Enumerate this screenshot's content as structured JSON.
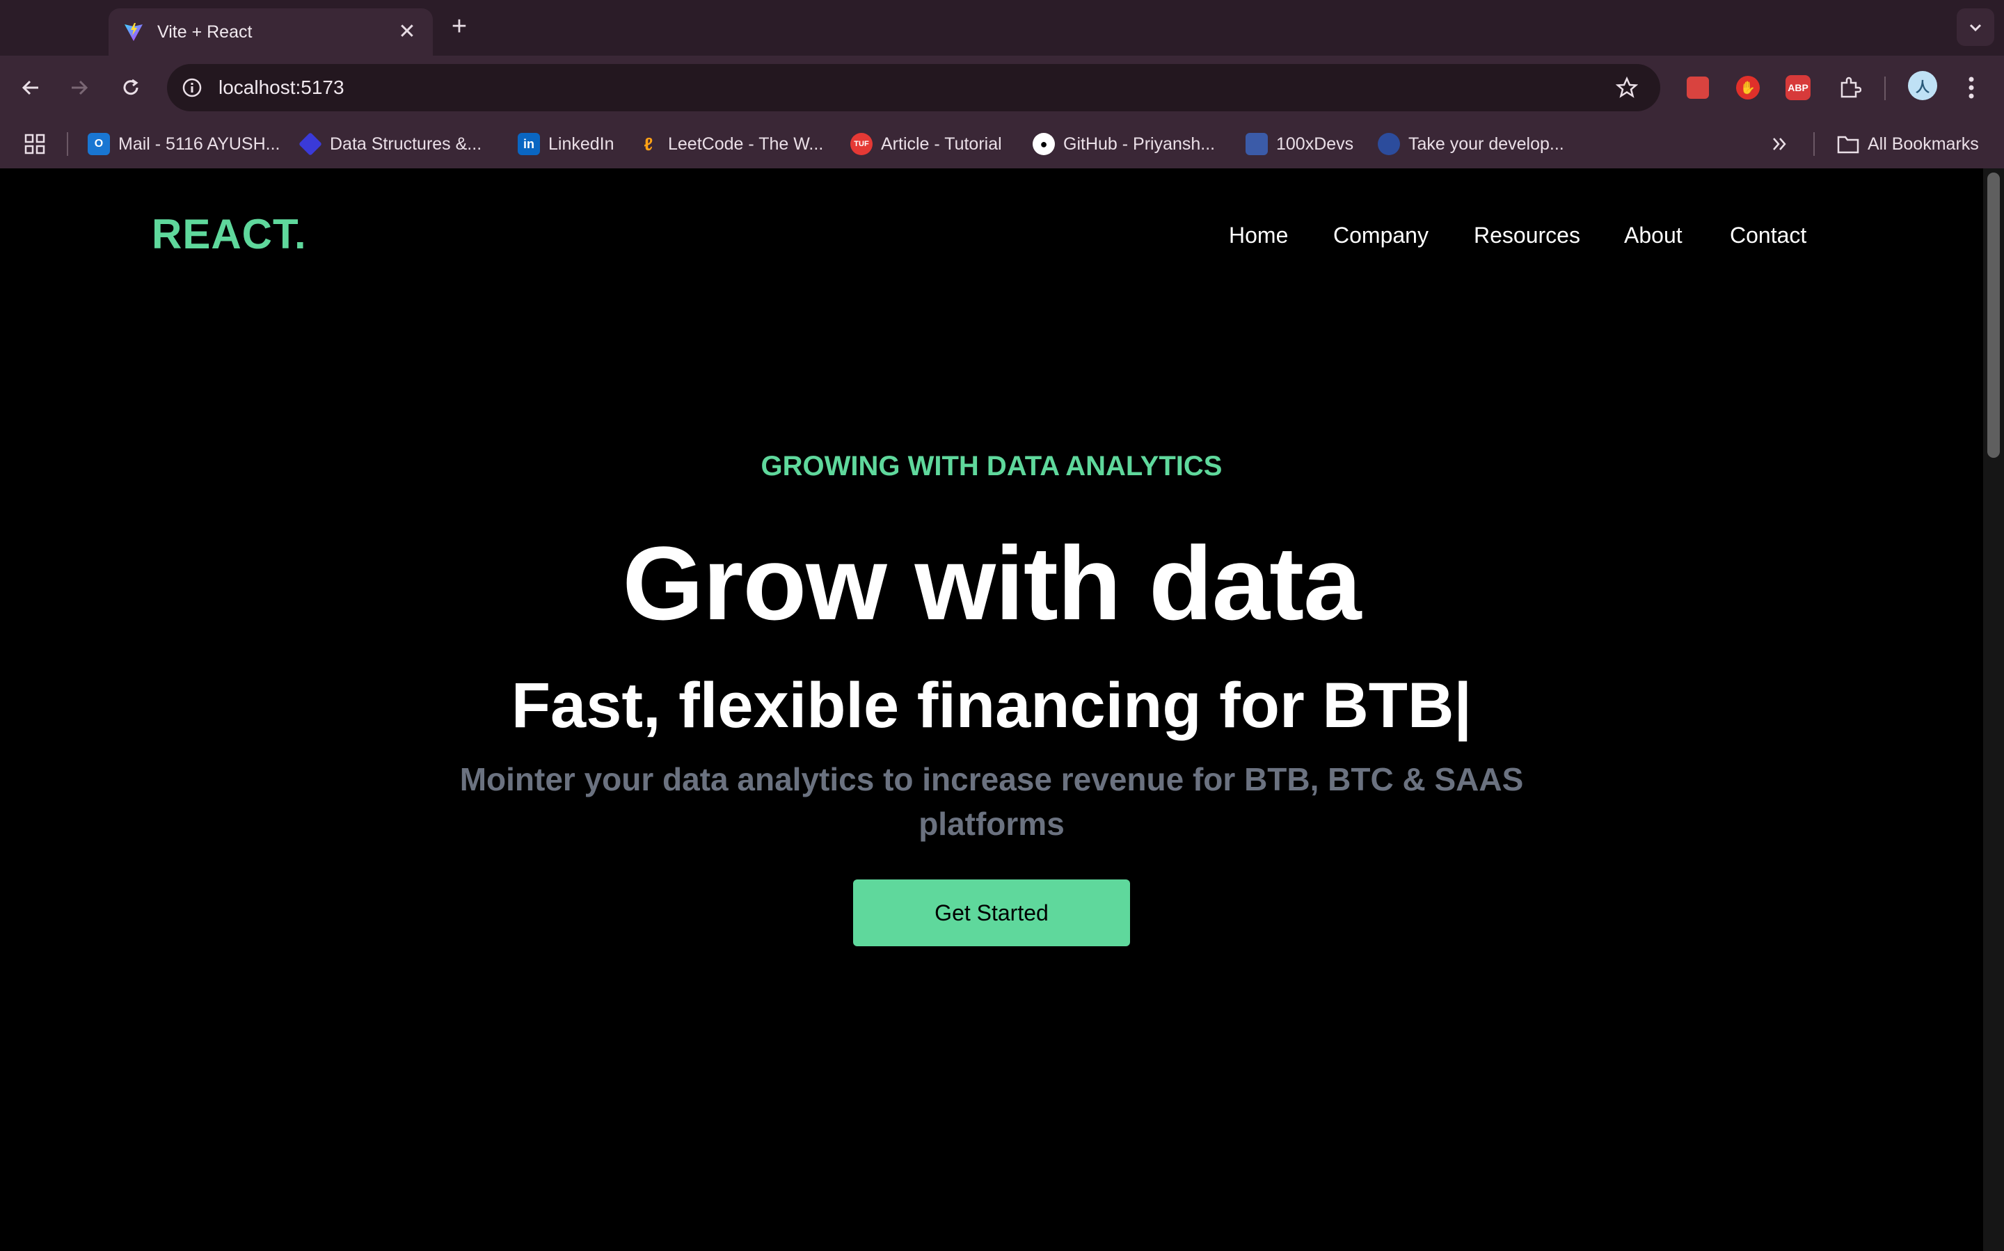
{
  "browser": {
    "tab_title": "Vite + React",
    "url": "localhost:5173",
    "bookmarks": [
      {
        "label": "Mail - 5116 AYUSH...",
        "icon": "outlook-icon",
        "color": "#1976d2"
      },
      {
        "label": "Data Structures &...",
        "icon": "code-icon",
        "color": "#3a3ad8"
      },
      {
        "label": "LinkedIn",
        "icon": "linkedin-icon",
        "color": "#0a66c2"
      },
      {
        "label": "LeetCode - The W...",
        "icon": "leetcode-icon",
        "color": "#ffa116"
      },
      {
        "label": "Article - Tutorial",
        "icon": "tuf-icon",
        "color": "#e53935"
      },
      {
        "label": "GitHub - Priyansh...",
        "icon": "github-icon",
        "color": "#ffffff"
      },
      {
        "label": "100xDevs",
        "icon": "avatar-icon",
        "color": "#3b5ba8"
      },
      {
        "label": "Take your develop...",
        "icon": "avatar-icon",
        "color": "#2c4c9c"
      }
    ],
    "all_bookmarks": "All Bookmarks",
    "extensions": [
      {
        "icon": "extension-red-icon",
        "color": "#d9433f"
      },
      {
        "icon": "adblock-hand-icon",
        "color": "#e0302a"
      },
      {
        "label": "ABP",
        "icon": "abp-icon",
        "color": "#d73a3a"
      }
    ]
  },
  "site": {
    "logo": "REACT.",
    "nav": [
      "Home",
      "Company",
      "Resources",
      "About",
      "Contact"
    ],
    "eyebrow": "GROWING WITH DATA ANALYTICS",
    "headline": "Grow with data",
    "subhead": "Fast, flexible financing for BTB|",
    "description": "Mointer your data analytics to increase revenue for BTB, BTC & SAAS platforms",
    "cta": "Get Started"
  },
  "colors": {
    "accent": "#5fd89c",
    "background": "#000000",
    "muted_text": "#6b7280",
    "chrome": "#3a2736"
  }
}
